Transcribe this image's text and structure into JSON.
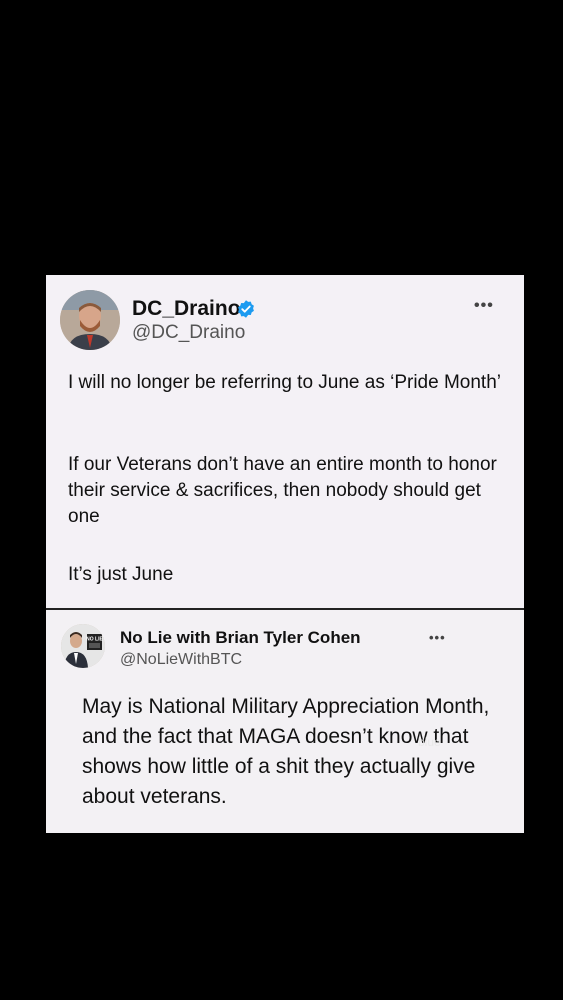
{
  "tweet1": {
    "name": "DC_Draino",
    "handle": "@DC_Draino",
    "verified": true,
    "more_label": "•••",
    "paragraphs": [
      "I will no longer be referring to June as ‘Pride Month’",
      "If our Veterans don’t have an entire month to honor their service & sacrifices, then nobody should get one",
      "It’s just June"
    ]
  },
  "tweet2": {
    "name": "No Lie with Brian Tyler Cohen",
    "handle": "@NoLieWithBTC",
    "more_label": "•••",
    "avatar_text": "NO LIE",
    "body": "May is National Military Appreciation Month, and the fact that MAGA doesn’t know that shows how little of a shit they actually give about veterans."
  },
  "watermark": "blue",
  "colors": {
    "card_bg": "#f4f1f6",
    "verified": "#1d9bf0",
    "background": "#000000"
  }
}
